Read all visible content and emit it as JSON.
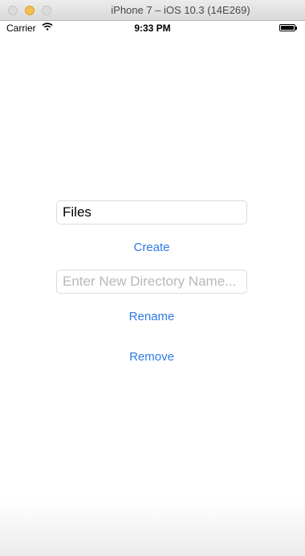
{
  "window": {
    "title": "iPhone 7 – iOS 10.3 (14E269)"
  },
  "status_bar": {
    "carrier": "Carrier",
    "time": "9:33 PM",
    "wifi_icon": "wifi-icon",
    "battery_icon": "battery-icon"
  },
  "form": {
    "name_field_value": "Files",
    "create_label": "Create",
    "new_dir_placeholder": "Enter New Directory Name...",
    "rename_label": "Rename",
    "remove_label": "Remove"
  },
  "colors": {
    "accent": "#2f7ae5",
    "caret": "#1d5fd0"
  }
}
